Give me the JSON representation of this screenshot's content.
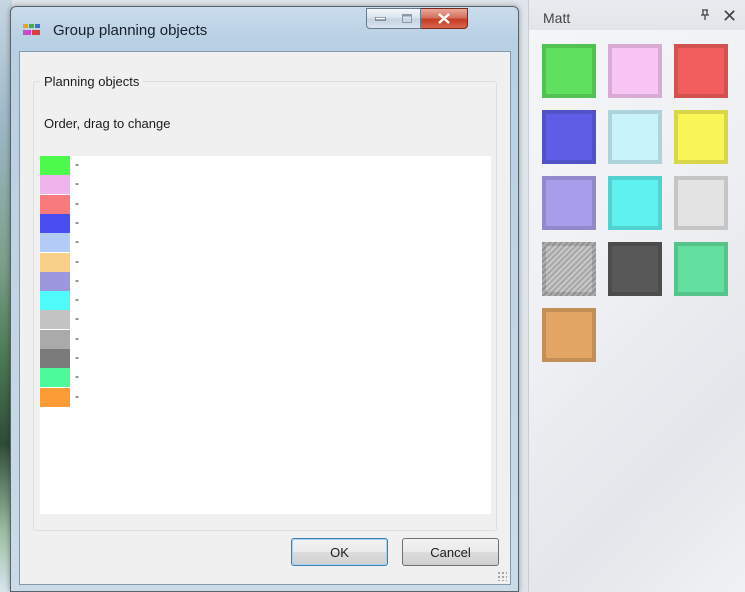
{
  "dialog": {
    "title": "Group planning objects",
    "group_label": "Planning objects",
    "instruction": "Order, drag to change",
    "items": [
      {
        "label": "-",
        "color": "#4cfa4c"
      },
      {
        "label": "-",
        "color": "#f0b4ec"
      },
      {
        "label": "-",
        "color": "#f87a7c"
      },
      {
        "label": "-",
        "color": "#4a4ef2"
      },
      {
        "label": "-",
        "color": "#b2ccf7"
      },
      {
        "label": "-",
        "color": "#f9d08a"
      },
      {
        "label": "-",
        "color": "#9c96dc"
      },
      {
        "label": "-",
        "color": "#4efafa"
      },
      {
        "label": "-",
        "color": "#c3c3c3"
      },
      {
        "label": "-",
        "color": "#aaaaaa"
      },
      {
        "label": "-",
        "color": "#7a7a7a"
      },
      {
        "label": "-",
        "color": "#4cfa9c"
      },
      {
        "label": "-",
        "color": "#fb9c36"
      }
    ],
    "ok_label": "OK",
    "cancel_label": "Cancel"
  },
  "panel": {
    "title": "Matt",
    "pin_glyph": "ᵖ",
    "close_glyph": "✕",
    "tiles": [
      {
        "color": "#5fe05f"
      },
      {
        "color": "#f9c5f5"
      },
      {
        "color": "#f25e5e"
      },
      {
        "color": "#5d5de6"
      },
      {
        "color": "#c8f3fb"
      },
      {
        "color": "#fbf657"
      },
      {
        "color": "#a79eeb"
      },
      {
        "color": "#5ff0f0"
      },
      {
        "color": "#e3e3e3"
      },
      {
        "color": "#a7a7a7",
        "pattern": "hatched"
      },
      {
        "color": "#585858"
      },
      {
        "color": "#63e09f"
      },
      {
        "color": "#e2a563"
      }
    ]
  }
}
